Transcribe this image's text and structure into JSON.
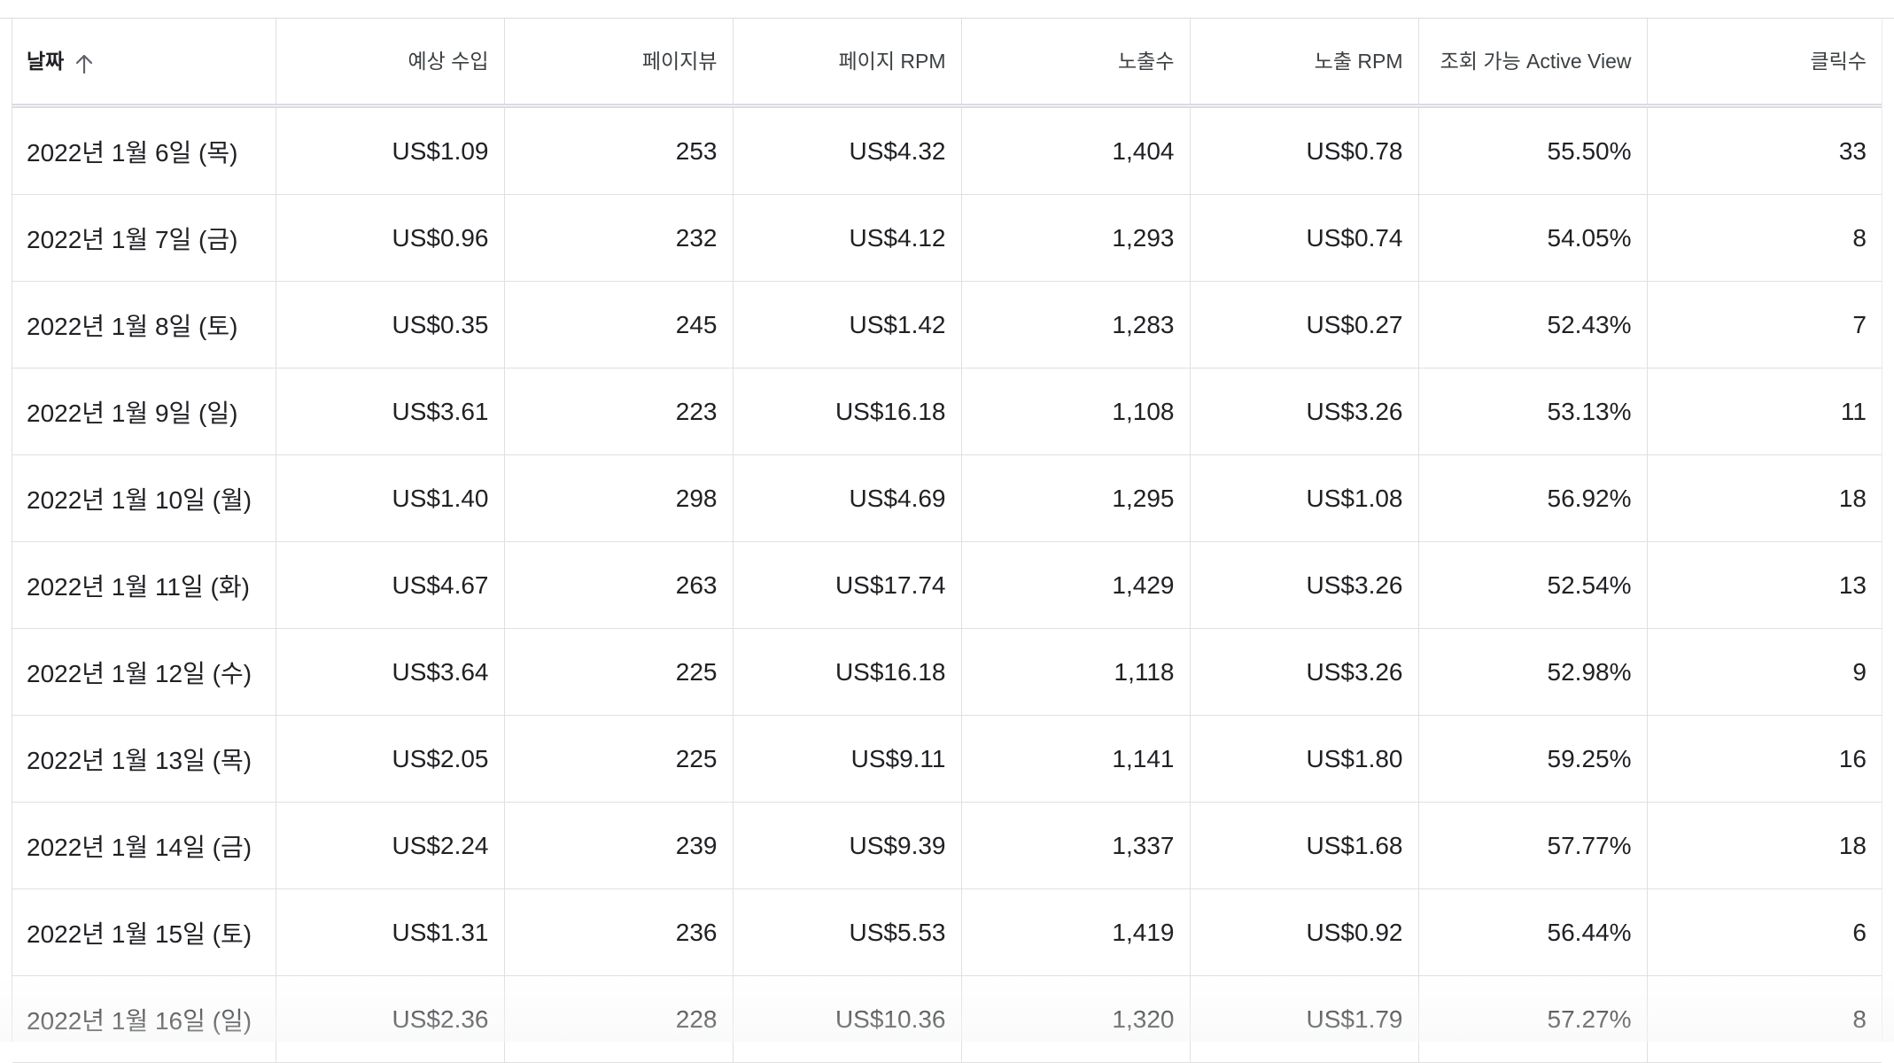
{
  "table": {
    "columns": [
      {
        "label": "날짜"
      },
      {
        "label": "예상 수입"
      },
      {
        "label": "페이지뷰"
      },
      {
        "label": "페이지 RPM"
      },
      {
        "label": "노출수"
      },
      {
        "label": "노출 RPM"
      },
      {
        "label": "조회 가능 Active View"
      },
      {
        "label": "클릭수"
      }
    ],
    "sort": {
      "column": "날짜",
      "direction": "ascending",
      "icon": "arrow-up-icon"
    },
    "rows": [
      {
        "cells": [
          "2022년 1월 6일 (목)",
          "US$1.09",
          "253",
          "US$4.32",
          "1,404",
          "US$0.78",
          "55.50%",
          "33"
        ]
      },
      {
        "cells": [
          "2022년 1월 7일 (금)",
          "US$0.96",
          "232",
          "US$4.12",
          "1,293",
          "US$0.74",
          "54.05%",
          "8"
        ]
      },
      {
        "cells": [
          "2022년 1월 8일 (토)",
          "US$0.35",
          "245",
          "US$1.42",
          "1,283",
          "US$0.27",
          "52.43%",
          "7"
        ]
      },
      {
        "cells": [
          "2022년 1월 9일 (일)",
          "US$3.61",
          "223",
          "US$16.18",
          "1,108",
          "US$3.26",
          "53.13%",
          "11"
        ]
      },
      {
        "cells": [
          "2022년 1월 10일 (월)",
          "US$1.40",
          "298",
          "US$4.69",
          "1,295",
          "US$1.08",
          "56.92%",
          "18"
        ]
      },
      {
        "cells": [
          "2022년 1월 11일 (화)",
          "US$4.67",
          "263",
          "US$17.74",
          "1,429",
          "US$3.26",
          "52.54%",
          "13"
        ]
      },
      {
        "cells": [
          "2022년 1월 12일 (수)",
          "US$3.64",
          "225",
          "US$16.18",
          "1,118",
          "US$3.26",
          "52.98%",
          "9"
        ]
      },
      {
        "cells": [
          "2022년 1월 13일 (목)",
          "US$2.05",
          "225",
          "US$9.11",
          "1,141",
          "US$1.80",
          "59.25%",
          "16"
        ]
      },
      {
        "cells": [
          "2022년 1월 14일 (금)",
          "US$2.24",
          "239",
          "US$9.39",
          "1,337",
          "US$1.68",
          "57.77%",
          "18"
        ]
      },
      {
        "cells": [
          "2022년 1월 15일 (토)",
          "US$1.31",
          "236",
          "US$5.53",
          "1,419",
          "US$0.92",
          "56.44%",
          "6"
        ]
      },
      {
        "cells": [
          "2022년 1월 16일 (일)",
          "US$2.36",
          "228",
          "US$10.36",
          "1,320",
          "US$1.79",
          "57.27%",
          "8"
        ]
      }
    ]
  },
  "colors": {
    "text": "#202124",
    "header_text": "#3c4043",
    "grid_line": "#e0e0e0",
    "background": "#ffffff"
  }
}
